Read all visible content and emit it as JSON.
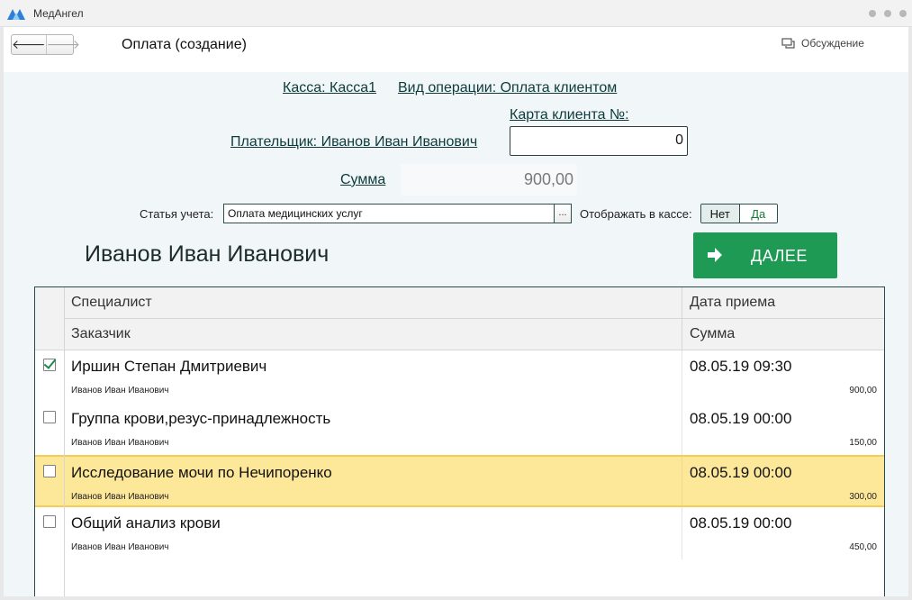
{
  "app": {
    "name": "МедАнгел"
  },
  "toolbar": {
    "back": "🡐",
    "forward": "🡒",
    "title": "Оплата (создание)",
    "discussion": "Обсуждение"
  },
  "form": {
    "cash_register": "Касса: Касса1",
    "operation_type": "Вид операции: Оплата клиентом",
    "client_card_label": "Карта клиента №:",
    "client_card_value": "0",
    "payer": "Плательщик: Иванов Иван Иванович",
    "sum_label": "Сумма",
    "sum_value": "900,00",
    "article_label": "Статья учета:",
    "article_value": "Оплата медицинских услуг",
    "article_button": "...",
    "display_label": "Отображать в кассе:",
    "display_no": "Нет",
    "display_yes": "Да",
    "display_selected": "Да"
  },
  "client_name": "Иванов Иван Иванович",
  "next_button": "ДАЛЕЕ",
  "colors": {
    "accent": "#1f9a55",
    "selected_row": "#fde89a",
    "text": "#111111"
  },
  "table": {
    "headers": {
      "specialist": "Специалист",
      "date": "Дата приема",
      "customer": "Заказчик",
      "amount": "Сумма"
    },
    "rows": [
      {
        "checked": true,
        "selected": false,
        "specialist": "Иршин Степан Дмитриевич",
        "date": "08.05.19 09:30",
        "customer": "Иванов Иван Иванович",
        "amount": "900,00"
      },
      {
        "checked": false,
        "selected": false,
        "specialist": "Группа крови,резус-принадлежность",
        "date": "08.05.19 00:00",
        "customer": "Иванов Иван Иванович",
        "amount": "150,00"
      },
      {
        "checked": false,
        "selected": true,
        "specialist": "Исследование мочи по Нечипоренко",
        "date": "08.05.19 00:00",
        "customer": "Иванов Иван Иванович",
        "amount": "300,00"
      },
      {
        "checked": false,
        "selected": false,
        "specialist": "Общий анализ крови",
        "date": "08.05.19 00:00",
        "customer": "Иванов Иван Иванович",
        "amount": "450,00"
      }
    ]
  }
}
